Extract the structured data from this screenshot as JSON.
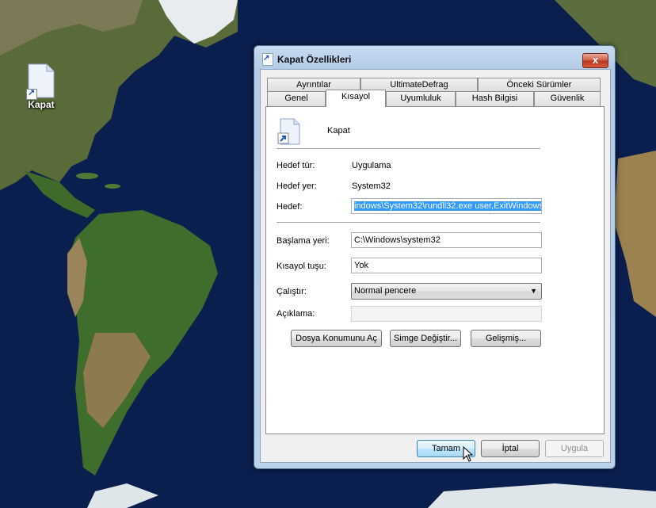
{
  "desktop": {
    "icon_label": "Kapat"
  },
  "window": {
    "title": "Kapat Özellikleri",
    "close_glyph": "x",
    "tabs_row1": [
      "Ayrıntılar",
      "UltimateDefrag",
      "Önceki Sürümler"
    ],
    "tabs_row2": [
      "Genel",
      "Kısayol",
      "Uyumluluk",
      "Hash Bilgisi",
      "Güvenlik"
    ],
    "active_tab": "Kısayol",
    "shortcut_name": "Kapat",
    "fields": {
      "target_type_label": "Hedef tür:",
      "target_type_value": "Uygulama",
      "target_location_label": "Hedef yer:",
      "target_location_value": "System32",
      "target_label": "Hedef:",
      "target_value": "indows\\System32\\rundll32.exe user,ExitWindows",
      "start_in_label": "Başlama yeri:",
      "start_in_value": "C:\\Windows\\system32",
      "shortcut_key_label": "Kısayol tuşu:",
      "shortcut_key_value": "Yok",
      "run_label": "Çalıştır:",
      "run_value": "Normal pencere",
      "comment_label": "Açıklama:",
      "comment_value": ""
    },
    "buttons": {
      "open_location": "Dosya Konumunu Aç",
      "change_icon": "Simge Değiştir...",
      "advanced": "Gelişmiş...",
      "ok": "Tamam",
      "cancel": "İptal",
      "apply": "Uygula"
    }
  },
  "colors": {
    "selection": "#3399ff",
    "ocean": "#0b1f4f"
  }
}
